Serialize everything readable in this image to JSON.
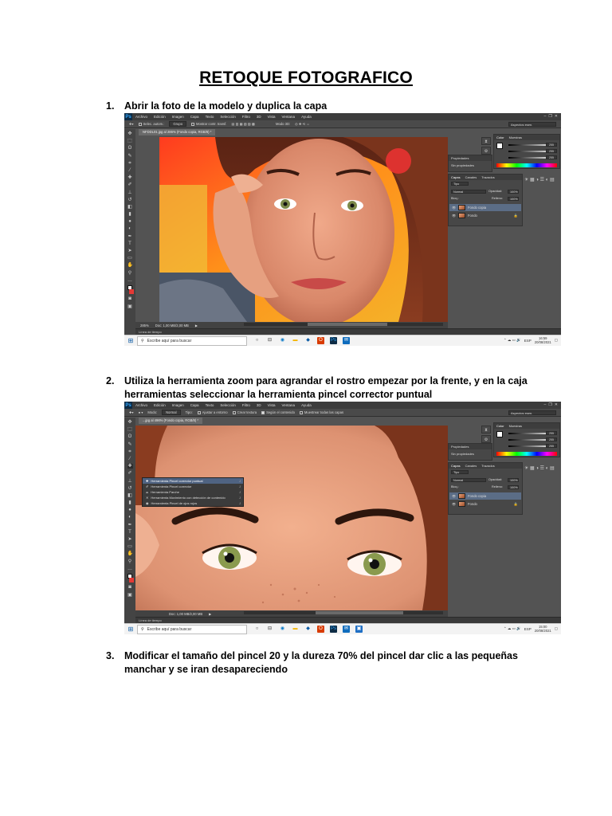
{
  "document": {
    "title": "RETOQUE FOTOGRAFICO",
    "steps": [
      {
        "num": "1.",
        "text": "Abrir la foto de la modelo y duplica la capa"
      },
      {
        "num": "2.",
        "text": "Utiliza la herramienta zoom para agrandar el rostro empezar por la frente, y en la caja herramientas seleccionar la herramienta pincel corrector puntual"
      },
      {
        "num": "3.",
        "text": "Modificar el tamaño del pincel 20 y la dureza 70% del pincel dar clic a las pequeñas manchar y se iran desapareciendo"
      }
    ]
  },
  "photoshop": {
    "logo": "Ps",
    "menu": [
      "Archivo",
      "Edición",
      "Imagen",
      "Capa",
      "Texto",
      "Selección",
      "Filtro",
      "3D",
      "Vista",
      "Ventana",
      "Ayuda"
    ],
    "window_controls": [
      "–",
      "❐",
      "✕"
    ],
    "workspace": "Aspectos esen.",
    "properties_title": "Propiedades",
    "properties_value": "Sin propiedades",
    "layers_tabs": [
      "Capas",
      "Canales",
      "Trazados"
    ],
    "blend_mode": "Normal",
    "kind": "Tipo",
    "opacity_label": "Opacidad:",
    "opacity_value": "100%",
    "fill_label": "Relleno:",
    "fill_value": "100%",
    "lock_label": "Bloq.:",
    "color_tabs": [
      "Color",
      "Muestras"
    ],
    "color_values": [
      "255",
      "255",
      "255"
    ]
  },
  "screenshot1": {
    "options": {
      "select_label": "Selec. autom.:",
      "select_value": "Grupo",
      "transform_label": "Mostrar contr. transf.",
      "mode3d": "Modo 3D:"
    },
    "doc_tab": "NFDDL01.jpg al 286% (Fondo copia, RGB/8) *",
    "zoom": "285%",
    "doc_size": "Doc: 1,00 MB/2,00 MB",
    "timeline": "Línea de tiempo",
    "layers": [
      {
        "name": "Fondo copia",
        "selected": true
      },
      {
        "name": "Fondo",
        "selected": false
      }
    ],
    "taskbar": {
      "search": "Escribe aquí para buscar",
      "lang": "ESP",
      "time": "16:59",
      "date": "20/08/2021"
    }
  },
  "screenshot2": {
    "options": {
      "mode_label": "Modo:",
      "mode_value": "Normal",
      "type_label": "Tipo:",
      "type1": "Ajustar a entorno",
      "type2": "Crear textura",
      "type3": "Según el contenido",
      "sample": "Muestrear todas las capas"
    },
    "doc_tab": "...jpg al 496% (Fondo copia, RGB/8) *",
    "doc_size": "Doc: 1,00 MB/2,00 MB",
    "timeline": "Línea de tiempo",
    "flyout": [
      {
        "label": "Herramienta Pincel corrector puntual",
        "key": "J",
        "selected": true
      },
      {
        "label": "Herramienta Pincel corrector",
        "key": "J",
        "selected": false
      },
      {
        "label": "Herramienta Parche",
        "key": "J",
        "selected": false
      },
      {
        "label": "Herramienta Movimiento con detección de contenido",
        "key": "J",
        "selected": false
      },
      {
        "label": "Herramienta Pincel de ojos rojos",
        "key": "J",
        "selected": false
      }
    ],
    "layers": [
      {
        "name": "Fondo copia",
        "selected": true
      },
      {
        "name": "Fondo",
        "selected": false
      }
    ],
    "taskbar": {
      "search": "Escribe aquí para buscar",
      "lang": "ESP",
      "time": "15:00",
      "date": "20/08/2021"
    }
  }
}
